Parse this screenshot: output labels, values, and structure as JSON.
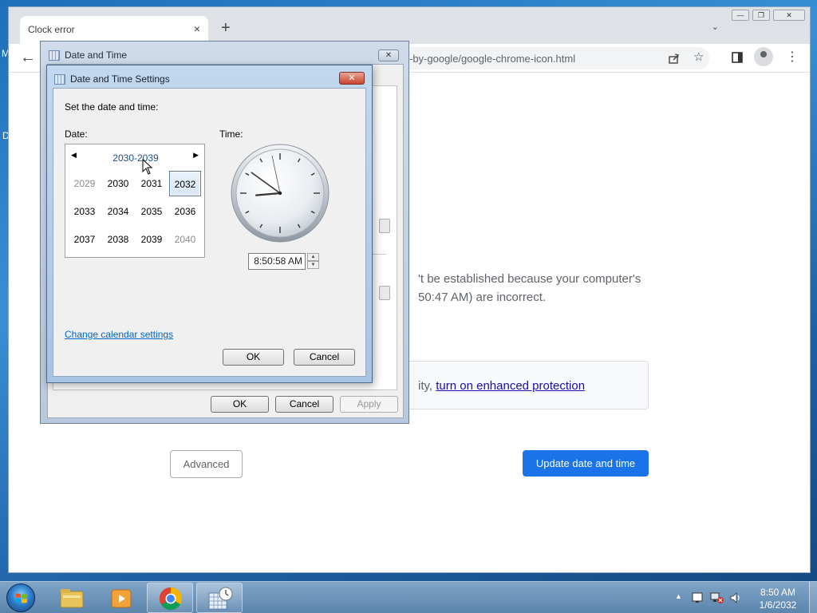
{
  "desktop": {
    "left_icon_letter_1": "M",
    "left_icon_letter_2": "D"
  },
  "chrome": {
    "tab_title": "Clock error",
    "tab_close": "×",
    "new_tab": "+",
    "tab_search": "⌄",
    "url": "-by-google/google-chrome-icon.html",
    "back": "←",
    "error_line1": "'t be established because your computer's",
    "error_line2": "50:47 AM) are incorrect.",
    "protection_prefix": "ity, ",
    "protection_link": "turn on enhanced protection",
    "advanced_label": "Advanced",
    "update_label": "Update date and time"
  },
  "date_time_dialog": {
    "title": "Date and Time",
    "close": "✕",
    "ok": "OK",
    "cancel": "Cancel",
    "apply": "Apply"
  },
  "settings_dialog": {
    "title": "Date and Time Settings",
    "close": "✕",
    "instruction": "Set the date and time:",
    "date_label": "Date:",
    "time_label": "Time:",
    "calendar": {
      "header": "2030-2039",
      "prev": "◀",
      "next": "▶",
      "years": [
        {
          "label": "2029",
          "dim": true
        },
        {
          "label": "2030",
          "dim": false
        },
        {
          "label": "2031",
          "dim": false
        },
        {
          "label": "2032",
          "dim": false,
          "selected": true
        },
        {
          "label": "2033",
          "dim": false
        },
        {
          "label": "2034",
          "dim": false
        },
        {
          "label": "2035",
          "dim": false
        },
        {
          "label": "2036",
          "dim": false
        },
        {
          "label": "2037",
          "dim": false
        },
        {
          "label": "2038",
          "dim": false
        },
        {
          "label": "2039",
          "dim": false
        },
        {
          "label": "2040",
          "dim": true
        }
      ]
    },
    "clock_time": {
      "hours": 8,
      "minutes": 50,
      "seconds": 58
    },
    "time_value": "8:50:58 AM",
    "spin_up": "▲",
    "spin_down": "▼",
    "change_calendar_link": "Change calendar settings",
    "ok": "OK",
    "cancel": "Cancel"
  },
  "taskbar": {
    "tray_arrow": "▲",
    "time": "8:50 AM",
    "date": "1/6/2032"
  },
  "colors": {
    "chrome_blue": "#1a73e8",
    "link_blue": "#0066cc",
    "close_red": "#c8432e"
  }
}
